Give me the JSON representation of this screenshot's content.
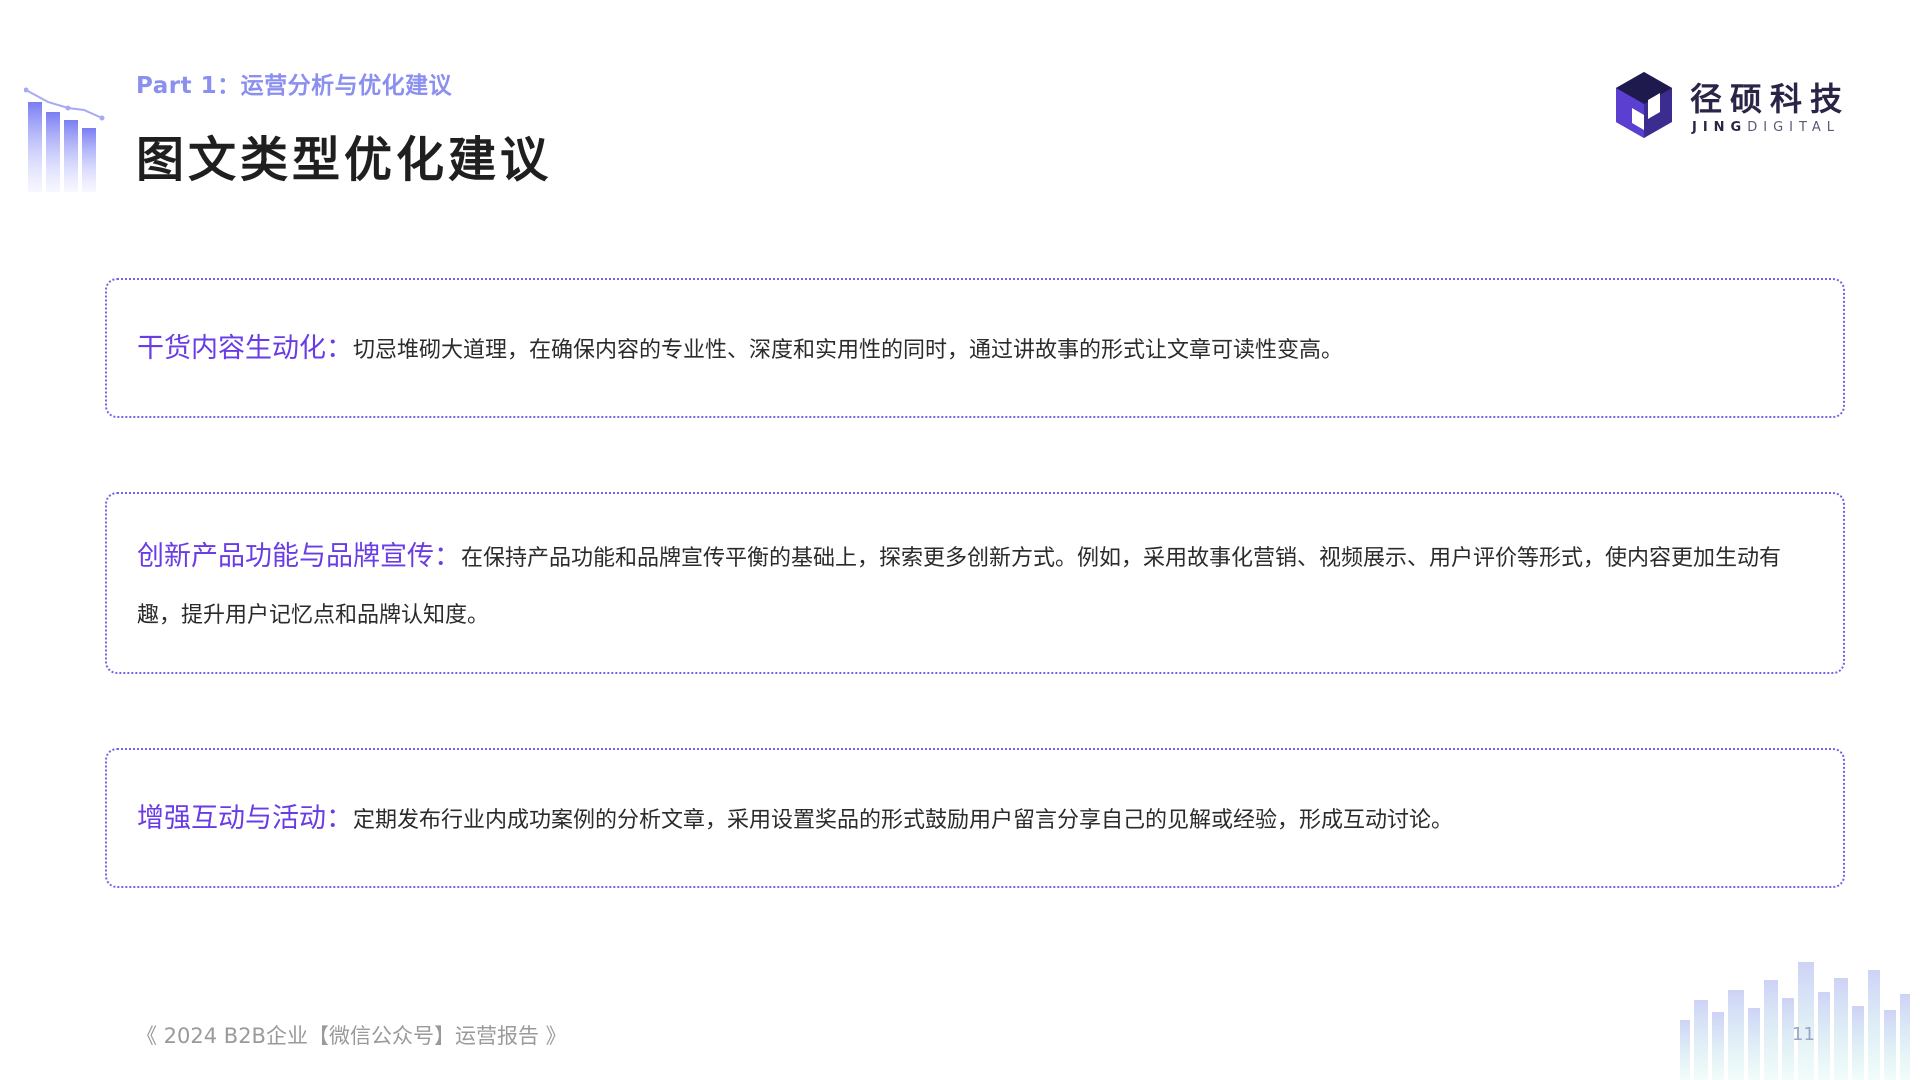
{
  "header": {
    "part_label": "Part 1：运营分析与优化建议",
    "title": "图文类型优化建议"
  },
  "logo": {
    "cn": "径硕科技",
    "en_bold": "JING",
    "en_light": "DIGITAL"
  },
  "cards": [
    {
      "heading": "干货内容生动化：",
      "text": "切忌堆砌大道理，在确保内容的专业性、深度和实用性的同时，通过讲故事的形式让文章可读性变高。"
    },
    {
      "heading": "创新产品功能与品牌宣传：",
      "text": "在保持产品功能和品牌宣传平衡的基础上，探索更多创新方式。例如，采用故事化营销、视频展示、用户评价等形式，使内容更加生动有趣，提升用户记忆点和品牌认知度。"
    },
    {
      "heading": "增强互动与活动：",
      "text": "定期发布行业内成功案例的分析文章，采用设置奖品的形式鼓励用户留言分享自己的见解或经验，形成互动讨论。"
    }
  ],
  "footer": {
    "report_title": "《 2024 B2B企业【微信公众号】运营报告 》",
    "page_number": "11"
  },
  "colors": {
    "accent": "#6a3ce6",
    "border": "#6f66e6",
    "part_label": "#8a8ff0",
    "logo": "#2a2547"
  }
}
